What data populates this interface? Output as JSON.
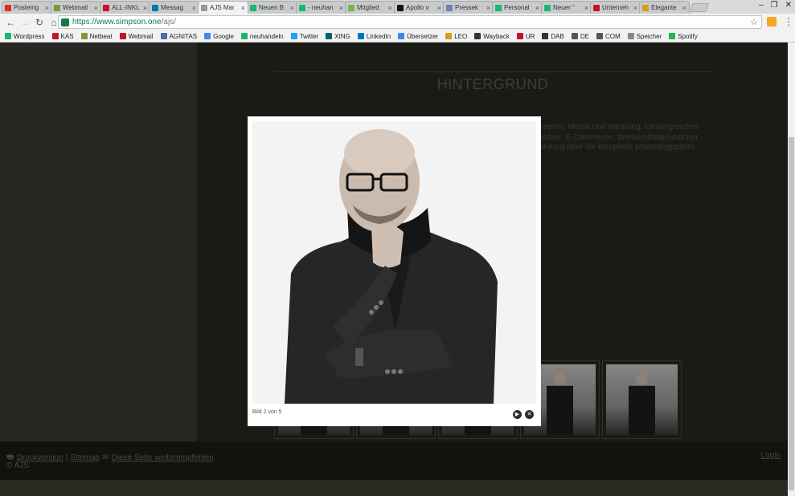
{
  "browser": {
    "tabs": [
      {
        "label": "Posteing",
        "color": "#d93025"
      },
      {
        "label": "Webmail",
        "color": "#7a9a3a"
      },
      {
        "label": "ALL-INKL",
        "color": "#c4122f"
      },
      {
        "label": "Messag",
        "color": "#0077b5"
      },
      {
        "label": "AJS Mar",
        "color": "#999999",
        "active": true
      },
      {
        "label": "Neuen B",
        "color": "#1bb76e"
      },
      {
        "label": "- neuhan",
        "color": "#1bb76e"
      },
      {
        "label": "Mitglied",
        "color": "#7ab648"
      },
      {
        "label": "Apollo v",
        "color": "#111111"
      },
      {
        "label": "Pressek",
        "color": "#6d7fb3"
      },
      {
        "label": "Personal",
        "color": "#1bb76e"
      },
      {
        "label": "Neuer \"",
        "color": "#1bb76e"
      },
      {
        "label": "Unterneh",
        "color": "#c4122f"
      },
      {
        "label": "Elegante",
        "color": "#d4a017"
      }
    ],
    "url_host": "https://www.simpson.one",
    "url_path": "/ajs/",
    "bookmarks": [
      {
        "label": "Wordpress",
        "color": "#1bb76e"
      },
      {
        "label": "KAS",
        "color": "#c4122f"
      },
      {
        "label": "Netbeat",
        "color": "#7a9a3a"
      },
      {
        "label": "Webmail",
        "color": "#c4122f"
      },
      {
        "label": "AGNITAS",
        "color": "#4a6fa5"
      },
      {
        "label": "Google",
        "color": "#4285f4"
      },
      {
        "label": "neuhandeln",
        "color": "#1bb76e"
      },
      {
        "label": "Twitter",
        "color": "#1da1f2"
      },
      {
        "label": "XING",
        "color": "#026466"
      },
      {
        "label": "LinkedIn",
        "color": "#0077b5"
      },
      {
        "label": "Übersetzer",
        "color": "#4285f4"
      },
      {
        "label": "LEO",
        "color": "#d4a017"
      },
      {
        "label": "Wayback",
        "color": "#333333"
      },
      {
        "label": "UR",
        "color": "#c4122f"
      },
      {
        "label": "DAB",
        "color": "#333333"
      },
      {
        "label": "DE",
        "color": "#555555"
      },
      {
        "label": "COM",
        "color": "#555555"
      },
      {
        "label": "Speicher",
        "color": "#888888"
      },
      {
        "label": "Spotify",
        "color": "#1db954"
      }
    ]
  },
  "page": {
    "heading": "HINTERGRUND",
    "paragraph_lines": [
      "mmerce, Media und Werbung. Umfangreiches",
      "Medien, E-Commerce, Werbemittelproduktion",
      "rfahrung über die komplette Marketingpalette"
    ],
    "footer": {
      "print_link": "Druckversion",
      "separator": "|",
      "sitemap_link": "Sitemap",
      "recommend_link": "Diese Seite weiterempfehlen",
      "copyright": "© AJS",
      "login_link": "Login"
    }
  },
  "lightbox": {
    "caption": "Bild 2 von 5",
    "current": 2,
    "total": 5
  }
}
